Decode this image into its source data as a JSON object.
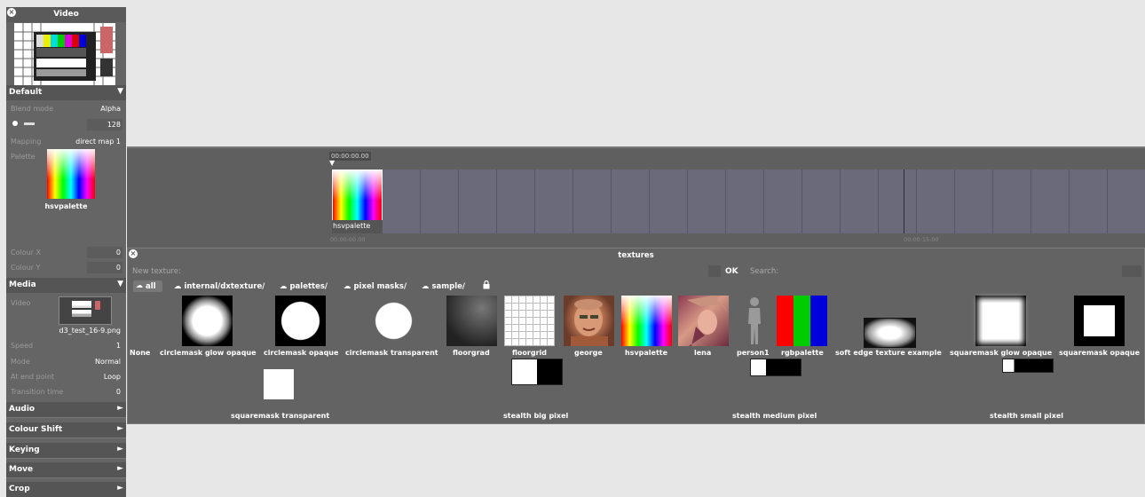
{
  "video_panel": {
    "title": "Video",
    "default_section": {
      "header": "Default",
      "blend_mode_label": "Blend mode",
      "blend_mode_value": "Alpha",
      "brightness_value": "128",
      "mapping_label": "Mapping",
      "mapping_value": "direct map 1",
      "palette_label": "Palette",
      "palette_name": "hsvpalette",
      "colour_x_label": "Colour X",
      "colour_x_value": "0",
      "colour_y_label": "Colour Y",
      "colour_y_value": "0"
    },
    "media_section": {
      "header": "Media",
      "video_label": "Video",
      "video_file": "d3_test_16-9.png",
      "speed_label": "Speed",
      "speed_value": "1",
      "mode_label": "Mode",
      "mode_value": "Normal",
      "end_point_label": "At end point",
      "end_point_value": "Loop",
      "transition_label": "Transition time",
      "transition_value": "0"
    },
    "collapsed_sections": [
      "Audio",
      "Colour Shift",
      "Keying",
      "Move",
      "Crop"
    ]
  },
  "timeline": {
    "playhead_time": "00:00:00.00",
    "clip_label": "hsvpalette",
    "start_time": "00:00:00.00",
    "mark_time": "00:00:15.00"
  },
  "textures_panel": {
    "title": "textures",
    "new_texture_label": "New texture:",
    "ok_label": "OK",
    "search_label": "Search:",
    "folders": [
      "all",
      "internal/dxtexture/",
      "palettes/",
      "pixel masks/",
      "sample/"
    ],
    "textures_row1": [
      "None",
      "circlemask glow opaque",
      "circlemask opaque",
      "circlemask transparent",
      "floorgrad",
      "floorgrid",
      "george",
      "hsvpalette",
      "lena",
      "person1",
      "rgbpalette",
      "soft edge texture example",
      "squaremask glow opaque",
      "squaremask opaque"
    ],
    "textures_row2": [
      "squaremask transparent",
      "stealth big pixel",
      "stealth medium pixel",
      "stealth small pixel"
    ]
  },
  "colors": {
    "page_bg": "#e6e7e6",
    "panel_bg": "#656565",
    "section_header_bg": "#555555",
    "timeline_frame": "#6b6a7b"
  }
}
